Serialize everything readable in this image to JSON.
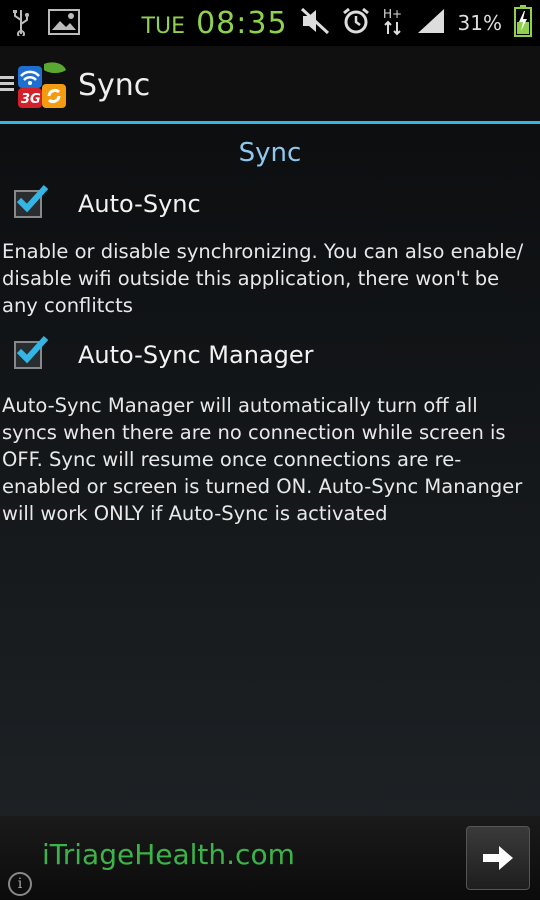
{
  "status_bar": {
    "day": "TUE",
    "time": "08:35",
    "battery": "31%",
    "icons": [
      "usb-icon",
      "image-icon",
      "mute-icon",
      "alarm-icon",
      "data-arrows-icon",
      "signal-icon",
      "battery-icon"
    ]
  },
  "appbar": {
    "title": "Sync",
    "logo_badge": "3G"
  },
  "content": {
    "section_title": "Sync",
    "auto_sync": {
      "label": "Auto-Sync",
      "checked": true,
      "description": "Enable or disable synchronizing. You can also enable/ disable wifi outside this application, there won't be any conflitcts"
    },
    "auto_sync_manager": {
      "label": "Auto-Sync Manager",
      "checked": true,
      "description": "Auto-Sync Manager will automatically turn off all syncs when there are no connection while screen is OFF. Sync will resume once connections are re-enabled or screen is turned ON. Auto-Sync Mananger will work ONLY if Auto-Sync is activated"
    }
  },
  "ad": {
    "text": "iTriageHealth.com",
    "info": "i"
  },
  "colors": {
    "accent": "#33b5e5",
    "status_green": "#8fd14f",
    "ad_green": "#3cb34a",
    "section_title": "#8fc8ef"
  }
}
